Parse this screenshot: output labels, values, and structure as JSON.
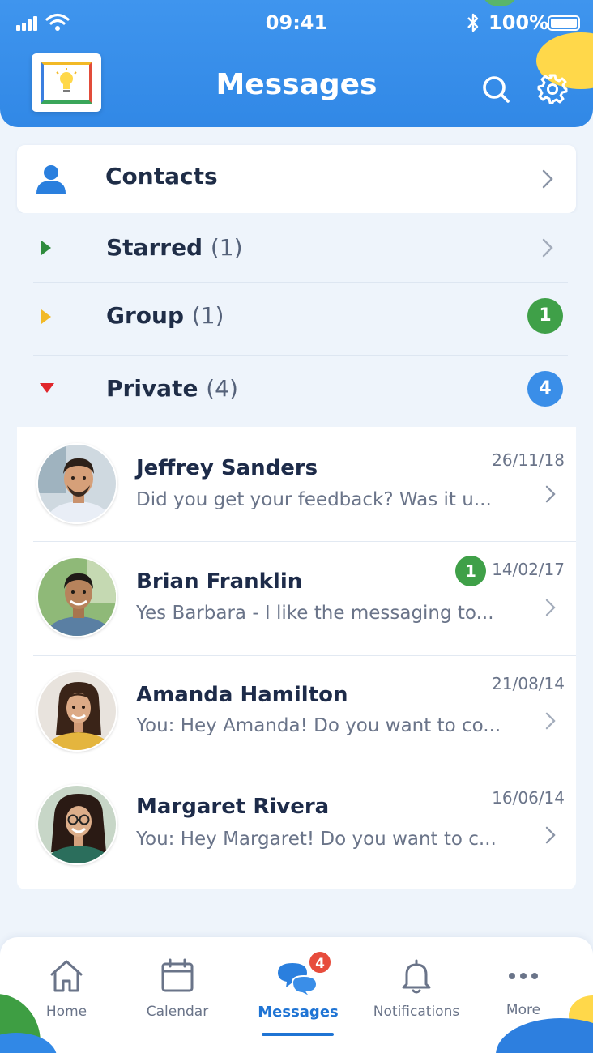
{
  "status_bar": {
    "time": "09:41",
    "battery": "100%"
  },
  "header": {
    "title": "Messages"
  },
  "contacts": {
    "label": "Contacts"
  },
  "folders": [
    {
      "label": "Starred",
      "count": "(1)",
      "badge": "",
      "arrow_color": "#2e8b3d"
    },
    {
      "label": "Group",
      "count": "(1)",
      "badge": "1",
      "arrow_color": "#f2b926",
      "badge_color": "#3fa048"
    },
    {
      "label": "Private",
      "count": "(4)",
      "badge": "4",
      "arrow_color": "#e0262b",
      "badge_color": "#3a8ee8"
    }
  ],
  "conversations": [
    {
      "name": "Jeffrey Sanders",
      "preview": "Did you get your feedback? Was it u...",
      "date": "26/11/18",
      "unread": ""
    },
    {
      "name": "Brian Franklin",
      "preview": "Yes Barbara - I like the messaging to...",
      "date": "14/02/17",
      "unread": "1"
    },
    {
      "name": "Amanda Hamilton",
      "preview": "You: Hey Amanda! Do you want to co...",
      "date": "21/08/14",
      "unread": ""
    },
    {
      "name": "Margaret Rivera",
      "preview": "You: Hey Margaret! Do you want to c...",
      "date": "16/06/14",
      "unread": ""
    }
  ],
  "bottom_nav": {
    "items": [
      {
        "label": "Home",
        "icon": "home-icon"
      },
      {
        "label": "Calendar",
        "icon": "calendar-icon"
      },
      {
        "label": "Messages",
        "icon": "messages-icon",
        "badge": "4",
        "active": true
      },
      {
        "label": "Notifications",
        "icon": "bell-icon"
      },
      {
        "label": "More",
        "icon": "more-icon"
      }
    ]
  },
  "colors": {
    "header_blue": "#3188e6",
    "accent": "#1f74d4",
    "badge_green": "#3fa048",
    "badge_red": "#e74c3c"
  }
}
